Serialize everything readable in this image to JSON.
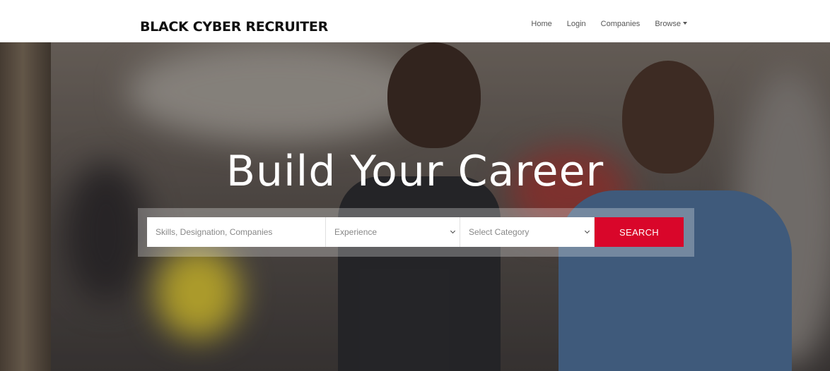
{
  "header": {
    "brand": "BLACK CYBER RECRUITER",
    "nav": {
      "home": "Home",
      "login": "Login",
      "companies": "Companies",
      "browse": "Browse"
    }
  },
  "hero": {
    "headline": "Build Your Career"
  },
  "search": {
    "skills_placeholder": "Skills, Designation, Companies",
    "experience_selected": "Experience",
    "category_selected": "Select Category",
    "button_label": "SEARCH"
  },
  "colors": {
    "accent": "#d9062a",
    "headline": "#ffffff"
  },
  "icons": {
    "browse_caret": "caret-down-icon",
    "select_chevron": "chevron-down-icon"
  }
}
